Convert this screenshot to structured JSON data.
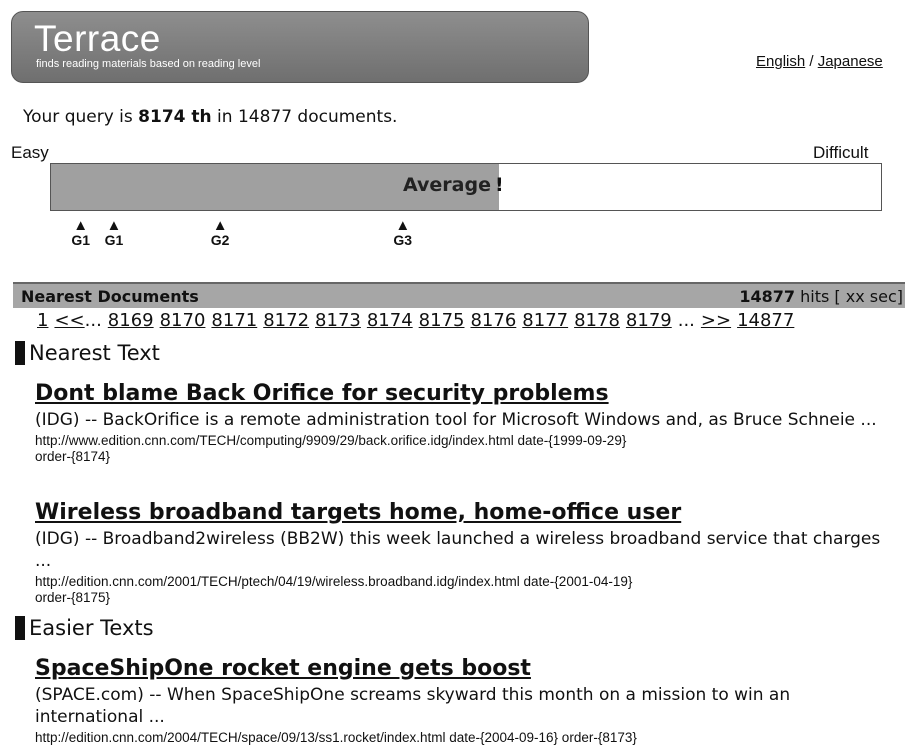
{
  "header": {
    "app_title": "Terrace",
    "tagline": "finds reading materials based on reading level",
    "lang_english": "English",
    "lang_sep": "/",
    "lang_japanese": "Japanese"
  },
  "query": {
    "prefix": "Your query is",
    "rank": "8174 th",
    "middle": "in 14877 documents."
  },
  "scale": {
    "easy_label": "Easy",
    "difficult_label": "Difficult",
    "level_label": "Average",
    "level_excl": "!",
    "level_fraction": 0.54,
    "markers": [
      {
        "label": "G1",
        "pos": 0.037
      },
      {
        "label": "G1",
        "pos": 0.077
      },
      {
        "label": "G2",
        "pos": 0.205
      },
      {
        "label": "G3",
        "pos": 0.425
      }
    ]
  },
  "docs_bar": {
    "title": "Nearest Documents",
    "hits_count": "14877",
    "hits_suffix": "hits [ xx sec]"
  },
  "pagination": {
    "first": "1",
    "prev": "<<",
    "ellipsis1": "...",
    "pages": [
      "8169",
      "8170",
      "8171",
      "8172",
      "8173",
      "8174",
      "8175",
      "8176",
      "8177",
      "8178",
      "8179"
    ],
    "ellipsis2": "...",
    "next": ">>",
    "last": "14877"
  },
  "sections": {
    "nearest": "Nearest Text",
    "easier": "Easier Texts"
  },
  "results": [
    {
      "title": "Dont blame Back Orifice for security problems",
      "snippet": "(IDG) -- BackOrifice is a remote administration tool for Microsoft Windows and, as Bruce Schneie ...",
      "url": "http://www.edition.cnn.com/TECH/computing/9909/29/back.orifice.idg/index.html date-{1999-09-29}",
      "order": "order-{8174}"
    },
    {
      "title": "Wireless broadband targets home, home-office user",
      "snippet": "(IDG) -- Broadband2wireless (BB2W) this week launched a wireless broadband service that charges ...",
      "url": "http://edition.cnn.com/2001/TECH/ptech/04/19/wireless.broadband.idg/index.html date-{2001-04-19}",
      "order": "order-{8175}"
    },
    {
      "title": "SpaceShipOne rocket engine gets boost",
      "snippet": "(SPACE.com) -- When SpaceShipOne screams skyward this month on a mission to win an international ...",
      "url": "http://edition.cnn.com/2004/TECH/space/09/13/ss1.rocket/index.html date-{2004-09-16} order-{8173}",
      "order": ""
    }
  ]
}
